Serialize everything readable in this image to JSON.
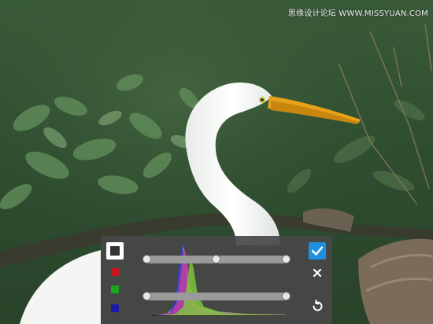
{
  "watermark": {
    "text": "思缘设计论坛 WWW.MISSYUAN.COM"
  },
  "levels_panel": {
    "channels": [
      {
        "name": "rgb",
        "color": "#ffffff"
      },
      {
        "name": "red",
        "color": "#c8161d"
      },
      {
        "name": "green",
        "color": "#19a81b"
      },
      {
        "name": "blue",
        "color": "#1c1ca8"
      }
    ],
    "input_levels": {
      "black": 0,
      "gamma": 0.5,
      "white": 1
    },
    "output_levels": {
      "black": 0,
      "white": 1
    },
    "histogram_colors": {
      "red": "#d43a9a",
      "green": "#7ccd3a",
      "blue": "#3a3ad4",
      "gray": "#b5b5b5"
    },
    "actions": {
      "confirm_icon": "checkmark-icon",
      "cancel_icon": "close-icon",
      "reset_icon": "reset-icon",
      "confirm_color": "#1f8fdf"
    }
  }
}
